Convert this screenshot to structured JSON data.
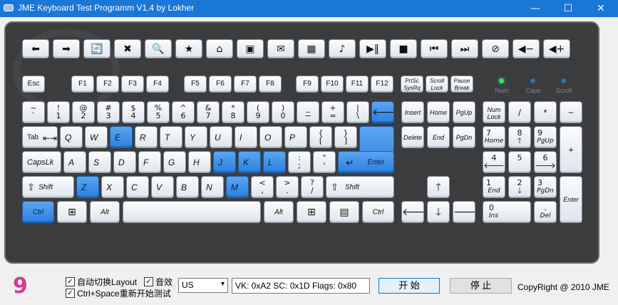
{
  "window": {
    "title": "JME Keyboard Test Programm V1.4 by Lokher",
    "minimize": "—",
    "maximize": "☐",
    "close": "✕"
  },
  "media_keys": [
    "⬅",
    "➡",
    "🔄",
    "✖",
    "🔍",
    "★",
    "⌂",
    "▣",
    "✉",
    "▦",
    "♪",
    "▶‖",
    "■",
    "⏮",
    "⏭",
    "⊘",
    "◀−",
    "◀+"
  ],
  "fn_row": {
    "esc": "Esc",
    "f": [
      "F1",
      "F2",
      "F3",
      "F4",
      "F5",
      "F6",
      "F7",
      "F8",
      "F9",
      "F10",
      "F11",
      "F12"
    ],
    "prtsc": [
      "PrtSc",
      "SysRq"
    ],
    "scroll": [
      "Scroll",
      "Lock"
    ],
    "pause": [
      "Pause",
      "Break"
    ]
  },
  "leds": [
    {
      "label": "Num",
      "color": "#3ee06a"
    },
    {
      "label": "Caps",
      "color": "#2d6ea8"
    },
    {
      "label": "Scroll",
      "color": "#2d6ea8"
    }
  ],
  "number_row": [
    {
      "up": "~",
      "lo": "`"
    },
    {
      "up": "!",
      "lo": "1"
    },
    {
      "up": "@",
      "lo": "2"
    },
    {
      "up": "#",
      "lo": "3"
    },
    {
      "up": "$",
      "lo": "4"
    },
    {
      "up": "%",
      "lo": "5"
    },
    {
      "up": "^",
      "lo": "6"
    },
    {
      "up": "&",
      "lo": "7"
    },
    {
      "up": "*",
      "lo": "8"
    },
    {
      "up": "(",
      "lo": "9"
    },
    {
      "up": ")",
      "lo": "0"
    },
    {
      "up": "_",
      "lo": "−"
    },
    {
      "up": "+",
      "lo": "="
    },
    {
      "up": "|",
      "lo": "\\"
    }
  ],
  "backspace": "🡐",
  "tab_label": "Tab",
  "q_row": [
    "Q",
    "W",
    "E",
    "R",
    "T",
    "Y",
    "U",
    "I",
    "O",
    "P"
  ],
  "q_row_brackets": [
    {
      "up": "{",
      "lo": "["
    },
    {
      "up": "}",
      "lo": "]"
    }
  ],
  "caps_label": "CapsLk",
  "a_row": [
    "A",
    "S",
    "D",
    "F",
    "G",
    "H",
    "J",
    "K",
    "L"
  ],
  "a_row_punct": [
    {
      "up": ":",
      "lo": ";"
    },
    {
      "up": "\"",
      "lo": "'"
    }
  ],
  "enter_label": "Enter",
  "shift_label": "Shift",
  "z_row": [
    "Z",
    "X",
    "C",
    "V",
    "B",
    "N",
    "M"
  ],
  "z_row_punct": [
    {
      "up": "<",
      "lo": ","
    },
    {
      "up": ">",
      "lo": "."
    },
    {
      "up": "?",
      "lo": "/"
    }
  ],
  "ctrl_label": "Ctrl",
  "alt_label": "Alt",
  "win_icon": "⊞",
  "menu_icon": "▤",
  "nav": {
    "ins": "Insert",
    "home": "Home",
    "pgup": "PgUp",
    "del": "Delete",
    "end": "End",
    "pgdn": "PgDn"
  },
  "arrows": {
    "up": "🡑",
    "left": "🡐",
    "down": "🡓",
    "right": "🡒"
  },
  "numpad": {
    "numlock": [
      "Num",
      "Lock"
    ],
    "div": "/",
    "mul": "*",
    "minus": "−",
    "plus": "+",
    "enter": "Enter",
    "n7": [
      "7",
      "Home"
    ],
    "n8": [
      "8",
      "🡑"
    ],
    "n9": [
      "9",
      "PgUp"
    ],
    "n4": [
      "4",
      "🡐"
    ],
    "n5": [
      "5",
      ""
    ],
    "n6": [
      "6",
      "🡒"
    ],
    "n1": [
      "1",
      "End"
    ],
    "n2": [
      "2",
      "🡓"
    ],
    "n3": [
      "3",
      "PgDn"
    ],
    "n0": [
      "0",
      "Ins"
    ],
    "dot": [
      ".",
      "Del"
    ]
  },
  "highlighted_keys": [
    "E",
    "J",
    "K",
    "L",
    "Z",
    "M",
    "Ctrl-left",
    "Backspace",
    "Enter"
  ],
  "highlight_color": "#3a8ee8",
  "bottom": {
    "count": "9",
    "auto_switch_label": "自动切换Layout",
    "auto_switch_checked": "✓",
    "sound_label": "音效",
    "sound_checked": "✓",
    "restart_label": "Ctrl+Space重新开始测试",
    "restart_checked": "✓",
    "layout_value": "US",
    "layout_arrow": "▾",
    "vk_text": "VK: 0xA2  SC: 0x1D  Flags: 0x80",
    "start_label": "开 始",
    "stop_label": "停 止",
    "copyright": "CopyRight @ 2010 JME"
  }
}
